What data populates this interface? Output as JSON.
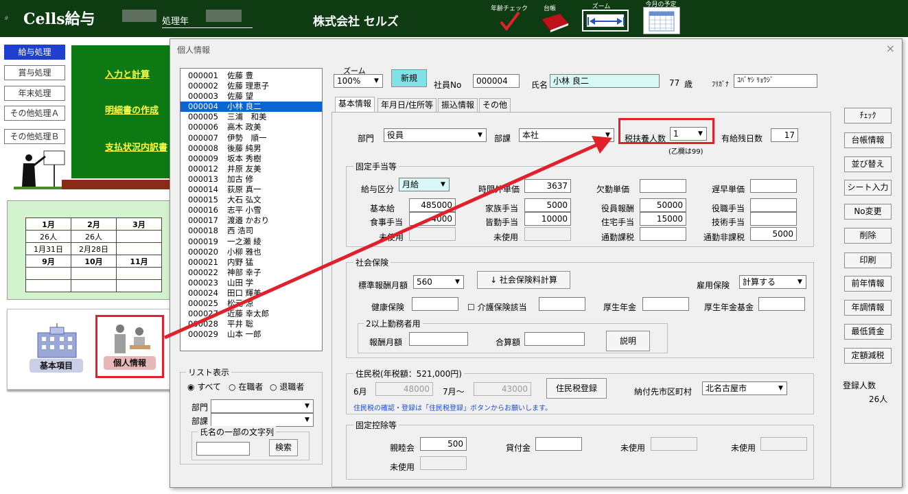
{
  "app": {
    "title": "Cells給与",
    "year_label": "処理年",
    "company": "株式会社 セルズ"
  },
  "toolbar": {
    "age_check": "年齢チェック",
    "ledger": "台帳",
    "zoom": "ズーム",
    "monthly_schedule": "今月の予定"
  },
  "sidebar": {
    "items": [
      {
        "label": "給与処理"
      },
      {
        "label": "賞与処理"
      },
      {
        "label": "年末処理"
      },
      {
        "label": "その他処理Ａ"
      },
      {
        "label": "その他処理Ｂ"
      }
    ]
  },
  "menu": {
    "input_calc": "入力と計算",
    "statement": "明細書の作成",
    "payment": "支払状況内訳書"
  },
  "calendar": {
    "months_top": [
      "1月",
      "2月",
      "3月"
    ],
    "counts": [
      "26人",
      "26人",
      ""
    ],
    "dates": [
      "1月31日",
      "2月28日",
      ""
    ],
    "months_bottom": [
      "9月",
      "10月",
      "11月"
    ]
  },
  "icons": {
    "basic": "基本項目",
    "personal": "個人情報"
  },
  "dialog": {
    "title": "個人情報",
    "close": "×",
    "zoom_label": "ズーム",
    "zoom_value": "100%",
    "new_button": "新規",
    "emp_no_label": "社員No",
    "emp_no": "000004",
    "name_label": "氏名",
    "name": "小林 良二",
    "age": "77",
    "age_unit": "歳",
    "furigana_label": "ﾌﾘｶﾞﾅ",
    "furigana": "ｺﾊﾞﾔｼ ﾘｮｳｼﾞ"
  },
  "employees": [
    {
      "no": "000001",
      "name": "佐藤 豊"
    },
    {
      "no": "000002",
      "name": "佐藤 理恵子"
    },
    {
      "no": "000003",
      "name": "佐藤 望"
    },
    {
      "no": "000004",
      "name": "小林 良二"
    },
    {
      "no": "000005",
      "name": "三浦　和美"
    },
    {
      "no": "000006",
      "name": "高木 政美"
    },
    {
      "no": "000007",
      "name": "伊勢　順一"
    },
    {
      "no": "000008",
      "name": "後藤 純男"
    },
    {
      "no": "000009",
      "name": "坂本 秀樹"
    },
    {
      "no": "000012",
      "name": "井原 友美"
    },
    {
      "no": "000013",
      "name": "加古 修"
    },
    {
      "no": "000014",
      "name": "荻原 真一"
    },
    {
      "no": "000015",
      "name": "大石 弘文"
    },
    {
      "no": "000016",
      "name": "志平 小雪"
    },
    {
      "no": "000017",
      "name": "渡邉 かおり"
    },
    {
      "no": "000018",
      "name": "西 浩司"
    },
    {
      "no": "000019",
      "name": "一之瀬 綾"
    },
    {
      "no": "000020",
      "name": "小柳 雅也"
    },
    {
      "no": "000021",
      "name": "内野 猛"
    },
    {
      "no": "000022",
      "name": "神部 幸子"
    },
    {
      "no": "000023",
      "name": "山田 学"
    },
    {
      "no": "000024",
      "name": "田口 輝美"
    },
    {
      "no": "000025",
      "name": "松元 涼"
    },
    {
      "no": "000027",
      "name": "近藤 幸太郎"
    },
    {
      "no": "000028",
      "name": "平井 聡"
    },
    {
      "no": "000029",
      "name": "山本 一郎"
    }
  ],
  "list_filter": {
    "title": "リスト表示",
    "all": "すべて",
    "current": "在職者",
    "retired": "退職者",
    "dept_label": "部門",
    "section_label": "部課",
    "search_group": "氏名の一部の文字列",
    "search_button": "検索"
  },
  "tabs": [
    "基本情報",
    "年月日/住所等",
    "振込情報",
    "その他"
  ],
  "basic": {
    "dept_label": "部門",
    "dept": "役員",
    "section_label": "部課",
    "section": "本社",
    "dependents_label": "税扶養人数",
    "dependents": "1",
    "dependents_note": "(乙欄は99)",
    "paid_leave_label": "有給残日数",
    "paid_leave": "17"
  },
  "allowances": {
    "title": "固定手当等",
    "pay_type_label": "給与区分",
    "pay_type": "月給",
    "overtime_label": "時間外単価",
    "overtime": "3637",
    "absence_label": "欠勤単価",
    "absence": "",
    "late_label": "遅早単価",
    "late": "",
    "base_label": "基本給",
    "base": "485000",
    "family_label": "家族手当",
    "family": "5000",
    "officer_label": "役員報酬",
    "officer": "50000",
    "position_label": "役職手当",
    "position": "",
    "meal_label": "食事手当",
    "meal": "4000",
    "attendance_label": "皆勤手当",
    "attendance": "10000",
    "housing_label": "住宅手当",
    "housing": "15000",
    "skill_label": "技術手当",
    "skill": "",
    "unused1_label": "未使用",
    "unused2_label": "未使用",
    "commute_tax_label": "通勤課税",
    "commute_tax": "",
    "commute_free_label": "通勤非課税",
    "commute_free": "5000"
  },
  "social": {
    "title": "社会保険",
    "std_label": "標準報酬月額",
    "std": "560",
    "calc_button": "↓ 社会保険料計算",
    "employment_label": "雇用保険",
    "employment": "計算する",
    "health_label": "健康保険",
    "health": "",
    "care_label": "介護保険該当",
    "care": "",
    "pension_label": "厚生年金",
    "pension": "",
    "pension_fund_label": "厚生年金基金",
    "pension_fund": "",
    "multi_title": "2以上勤務者用",
    "remun_label": "報酬月額",
    "total_label": "合算額",
    "explain_button": "説明"
  },
  "resident_tax": {
    "title": "住民税(年税額：521,000円)",
    "june_label": "6月",
    "june": "48000",
    "july_label": "7月～",
    "july": "43000",
    "register_button": "住民税登録",
    "city_label": "納付先市区町村",
    "city": "北名古屋市",
    "note": "住民税の確認・登録は「住民税登録」ボタンからお願いします。"
  },
  "deductions": {
    "title": "固定控除等",
    "social_club_label": "親睦会",
    "social_club": "500",
    "loan_label": "貸付金",
    "loan": "",
    "unused_label": "未使用"
  },
  "right_buttons": [
    "ﾁｪｯｸ",
    "台帳情報",
    "並び替え",
    "シート入力",
    "No変更",
    "削除",
    "印刷",
    "前年情報",
    "年調情報",
    "最低賃金",
    "定額減税"
  ],
  "registered": {
    "label": "登録人数",
    "count": "26人"
  },
  "colors": {
    "header_green": "#0e3b12",
    "menu_green": "#0d7a14",
    "selection_blue": "#0a64d2",
    "annotation_red": "#e0202a",
    "highlight_cyan": "#d8f8f8"
  }
}
